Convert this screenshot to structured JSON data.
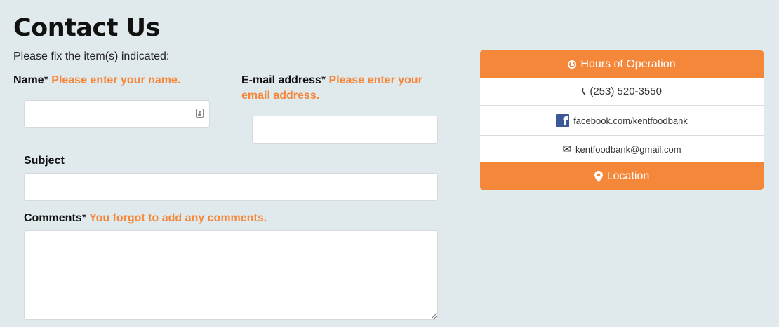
{
  "page": {
    "title": "Contact Us",
    "fix_message": "Please fix the item(s) indicated:"
  },
  "form": {
    "required_mark": "*",
    "name": {
      "label": "Name",
      "error": "Please enter your name.",
      "value": ""
    },
    "email": {
      "label": "E-mail address",
      "error_line1": "Please enter your",
      "error_line2": "email address.",
      "value": ""
    },
    "subject": {
      "label": "Subject",
      "value": ""
    },
    "comments": {
      "label": "Comments",
      "error": "You forgot to add any comments.",
      "value": ""
    }
  },
  "info_panel": {
    "hours_label": "Hours of Operation",
    "phone": "(253) 520-3550",
    "facebook": "facebook.com/kentfoodbank",
    "email": "kentfoodbank@gmail.com",
    "location_label": "Location",
    "accent_color": "#f5873a",
    "icons": {
      "hours": "clock-icon",
      "phone": "phone-icon",
      "facebook": "facebook-icon",
      "email": "envelope-icon",
      "location": "map-marker-icon"
    }
  }
}
